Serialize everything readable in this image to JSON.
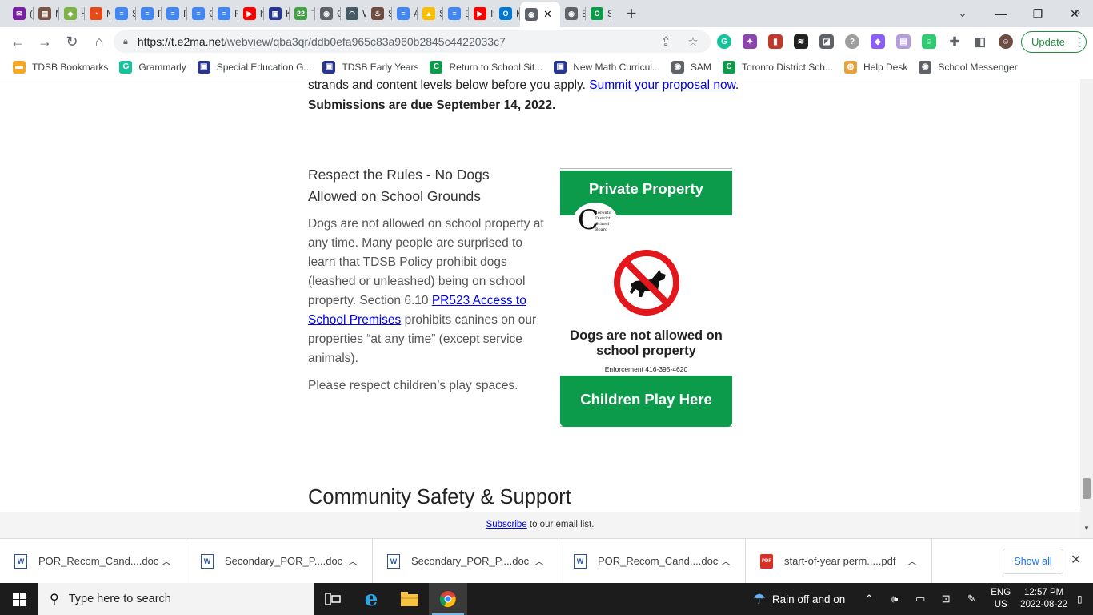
{
  "browser": {
    "tabs": [
      {
        "label": "(1",
        "color": "#7b1fa2",
        "glyph": "✉"
      },
      {
        "label": "M",
        "color": "#795548",
        "glyph": "▤"
      },
      {
        "label": "H",
        "color": "#7cb342",
        "glyph": "◆"
      },
      {
        "label": "M",
        "color": "#e64a19",
        "glyph": "◔"
      },
      {
        "label": "S",
        "color": "#4285f4",
        "glyph": "≡"
      },
      {
        "label": "P",
        "color": "#4285f4",
        "glyph": "≡"
      },
      {
        "label": "P",
        "color": "#4285f4",
        "glyph": "≡"
      },
      {
        "label": "C",
        "color": "#4285f4",
        "glyph": "≡"
      },
      {
        "label": "R",
        "color": "#4285f4",
        "glyph": "≡"
      },
      {
        "label": "h",
        "color": "#ff0000",
        "glyph": "▶"
      },
      {
        "label": "K",
        "color": "#283593",
        "glyph": "▣"
      },
      {
        "label": "T",
        "color": "#43a047",
        "glyph": "22"
      },
      {
        "label": "C",
        "color": "#5f6368",
        "glyph": "◉"
      },
      {
        "label": "W",
        "color": "#455a64",
        "glyph": "◠"
      },
      {
        "label": "S",
        "color": "#6d4c41",
        "glyph": "♨"
      },
      {
        "label": "A",
        "color": "#4285f4",
        "glyph": "≡"
      },
      {
        "label": "S",
        "color": "#fbbc04",
        "glyph": "▲"
      },
      {
        "label": "D",
        "color": "#4285f4",
        "glyph": "≡"
      },
      {
        "label": "It",
        "color": "#ff0000",
        "glyph": "▶"
      },
      {
        "label": "M",
        "color": "#0078d4",
        "glyph": "O"
      },
      {
        "label": "",
        "color": "#5f6368",
        "glyph": "◉",
        "active": true
      },
      {
        "label": "E",
        "color": "#5f6368",
        "glyph": "◉"
      },
      {
        "label": "S",
        "color": "#0c9b4b",
        "glyph": "C"
      }
    ],
    "new_tab": "+",
    "window_controls": {
      "minimize": "—",
      "maximize": "❐",
      "close": "✕"
    },
    "url_host": "https://t.e2ma.net",
    "url_path": "/webview/qba3qr/ddb0efa965c83a960b2845c4422033c7",
    "update_label": "Update",
    "bookmarks": [
      {
        "label": "TDSB Bookmarks",
        "color": "#f9a825",
        "glyph": "▬"
      },
      {
        "label": "Grammarly",
        "color": "#15c39a",
        "glyph": "G"
      },
      {
        "label": "Special Education G...",
        "color": "#283593",
        "glyph": "▣"
      },
      {
        "label": "TDSB Early Years",
        "color": "#283593",
        "glyph": "▣"
      },
      {
        "label": "Return to School Sit...",
        "color": "#0c9b4b",
        "glyph": "C"
      },
      {
        "label": "New Math Curricul...",
        "color": "#283593",
        "glyph": "▣"
      },
      {
        "label": "SAM",
        "color": "#5f6368",
        "glyph": "◉"
      },
      {
        "label": "Toronto District Sch...",
        "color": "#0c9b4b",
        "glyph": "C"
      },
      {
        "label": "Help Desk",
        "color": "#e8a33c",
        "glyph": "◍"
      },
      {
        "label": "School Messenger",
        "color": "#5f6368",
        "glyph": "◉"
      }
    ]
  },
  "content": {
    "intro_text": "strands and content levels below before you apply. ",
    "intro_link": "Summit your proposal now",
    "intro_end": ".",
    "deadline": "Submissions are due September 14, 2022.",
    "section_heading": "Respect the Rules - No Dogs Allowed on School Grounds",
    "body_part1": "Dogs are not allowed on school property at any time. Many people are surprised to learn that TDSB Policy prohibit dogs (leashed or unleashed) being on school property. Section 6.10 ",
    "body_link": "PR523 Access to School Premises",
    "body_part2": " prohibits canines on our properties “at any time” (except service animals).",
    "body_para2": "Please respect children’s play spaces.",
    "sign": {
      "top": "Private Property",
      "logo_text": "Toronto District School Board",
      "message": "Dogs are not allowed on school property",
      "enforcement": "Enforcement 416-395-4620",
      "bottom": "Children Play Here",
      "green": "#0c9b4b",
      "red": "#e3161c"
    },
    "next_section": "Community Safety & Support",
    "subscribe_link": "Subscribe",
    "subscribe_text": " to our email list."
  },
  "downloads": {
    "items": [
      {
        "name": "POR_Recom_Cand....doc",
        "type": "word"
      },
      {
        "name": "Secondary_POR_P....doc",
        "type": "word"
      },
      {
        "name": "Secondary_POR_P....doc",
        "type": "word"
      },
      {
        "name": "POR_Recom_Cand....doc",
        "type": "word"
      },
      {
        "name": "start-of-year perm.....pdf",
        "type": "pdf"
      }
    ],
    "show_all": "Show all"
  },
  "taskbar": {
    "search_placeholder": "Type here to search",
    "weather": "Rain off and on",
    "lang_line1": "ENG",
    "lang_line2": "US",
    "time": "12:57 PM",
    "date": "2022-08-22"
  }
}
